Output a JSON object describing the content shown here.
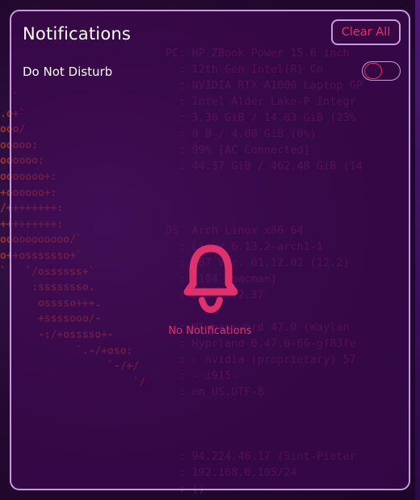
{
  "panel": {
    "title": "Notifications",
    "clear_all_label": "Clear All",
    "dnd_label": "Do Not Disturb",
    "dnd_enabled": false,
    "empty_text": "No Notifications",
    "empty_icon": "bell-icon",
    "accent_color": "#e1306c",
    "border_color": "#c89be0"
  },
  "background_terminal": {
    "lines": [
      "PC: HP ZBook Power 15.6 inch",
      "  : 12th Gen Intel(R) Co",
      "  : NVIDIA RTX A1000 Laptop GP",
      "  : Intel Alder Lake-P Integr",
      "  : 3.36 GiB / 14.83 GiB (23%",
      "  : 0 B / 4.00 GiB (0%)",
      "  : 99% [AC Connected]",
      "  : 44.37 GiB / 462.48 GiB (14",
      "",
      "",
      "",
      "OS  Arch Linux x86_64",
      "  : Linux 6.13.2-arch1-1",
      "  : U87 Ver. 01.12.02 (12.2)",
      "  : 1184 (pacman)",
      "  : bash 5.2.37",
      "",
      "  : Wl-password 47.0 (Waylan",
      "  : Hyprland 0.47.0-66-gf83fe",
      "  : - nvidia (proprietary) 57",
      "  : - i915-",
      "  : en_US.UTF-8",
      "",
      "",
      "",
      "  : 94.224.46.17 (Sint-Pieter",
      "  : 192.168.0.105/24",
      "  : ()"
    ],
    "ascii_art": [
      "  `",
      ".o+`",
      "ooo/",
      "ooooo:",
      "oooooo:",
      "ooooooo+:",
      "+oooooo+:",
      "/++++++++:",
      "+++++++++:",
      "ooooooooooo/`",
      "o++osssssso+`",
      "`   `/ossssss+`",
      "     :ssssssso.",
      "      osssso+++.",
      "      +ssssooo/-",
      "      -:/+osssso+-",
      "            `.-/+oso:",
      "                 `-/+/",
      "                     `/"
    ]
  }
}
